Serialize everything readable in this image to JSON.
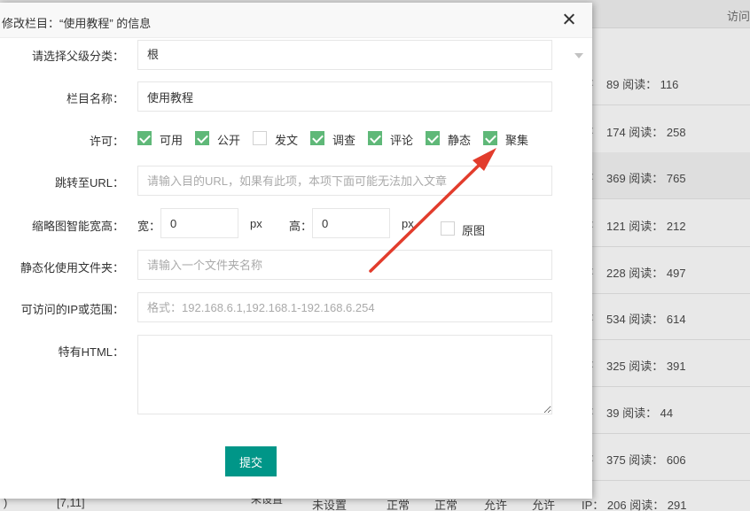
{
  "background": {
    "header_visits": "访问",
    "rows": [
      {
        "prefix": ":",
        "stat": "89 阅读： 116"
      },
      {
        "prefix": ":",
        "stat": "174 阅读： 258"
      },
      {
        "prefix": ":",
        "stat": "369 阅读： 765"
      },
      {
        "prefix": ":",
        "stat": "121 阅读： 212"
      },
      {
        "prefix": ":",
        "stat": "228 阅读： 497"
      },
      {
        "prefix": ":",
        "stat": "534 阅读： 614"
      },
      {
        "prefix": ":",
        "stat": "325 阅读： 391"
      },
      {
        "prefix": ":",
        "stat": "39 阅读： 44"
      },
      {
        "prefix": ":",
        "stat": "375 阅读： 606"
      }
    ],
    "bottom_row": {
      "paren": ")",
      "range": "[7,11]",
      "unset_short": "未设置",
      "unset": "未设置",
      "status1": "正常",
      "status2": "正常",
      "allow1": "允许",
      "allow2": "允许",
      "stat": "IP： 206 阅读： 291"
    }
  },
  "dialog": {
    "title": "修改栏目：“使用教程” 的信息",
    "parent_label": "请选择父级分类：",
    "parent_value": "根",
    "name_label": "栏目名称：",
    "name_value": "使用教程",
    "permit_label": "许可：",
    "permissions": [
      {
        "label": "可用",
        "checked": true
      },
      {
        "label": "公开",
        "checked": true
      },
      {
        "label": "发文",
        "checked": false
      },
      {
        "label": "调查",
        "checked": true
      },
      {
        "label": "评论",
        "checked": true
      },
      {
        "label": "静态",
        "checked": true
      },
      {
        "label": "聚集",
        "checked": true
      }
    ],
    "url_label": "跳转至URL：",
    "url_placeholder": "请输入目的URL，如果有此项，本项下面可能无法加入文章",
    "thumb_label": "缩略图智能宽高：",
    "width_label": "宽：",
    "width_value": "0",
    "height_label": "高：",
    "height_value": "0",
    "px_unit": "px",
    "original_label": "原图",
    "original_checked": false,
    "folder_label": "静态化使用文件夹：",
    "folder_placeholder": "请输入一个文件夹名称",
    "ip_label": "可访问的IP或范围：",
    "ip_placeholder": "格式：192.168.6.1,192.168.1-192.168.6.254",
    "html_label": "特有HTML：",
    "html_value": "",
    "submit_label": "提交"
  },
  "colors": {
    "accent": "#009688",
    "checkbox": "#5fb878",
    "arrow": "#e23c2c"
  }
}
